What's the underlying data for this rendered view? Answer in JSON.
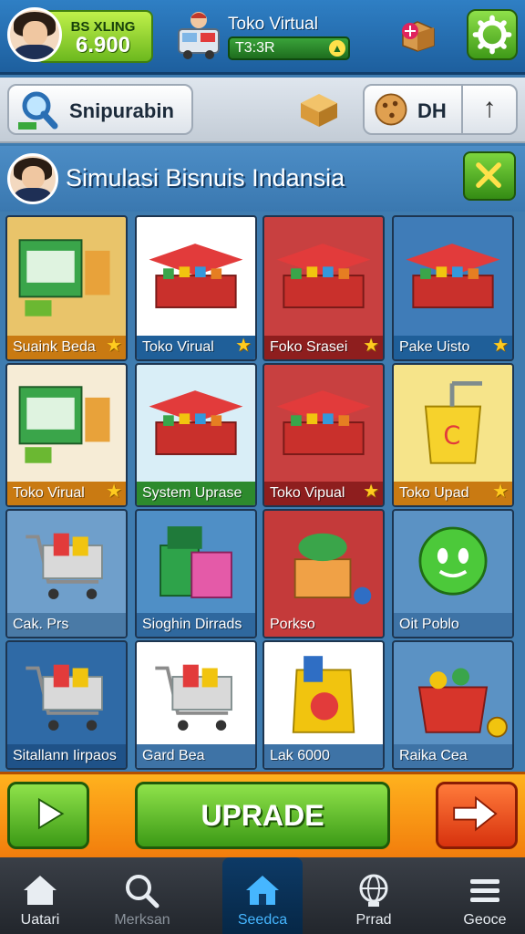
{
  "hud": {
    "balance_label": "BS XLING",
    "balance_value": "6.900",
    "store_name": "Toko Virtual",
    "timer": "T3:3R"
  },
  "toolbar": {
    "search_label": "Snipurabin",
    "dh_label": "DH"
  },
  "title": "Simulasi Bisnuis Indansia",
  "tiles": [
    {
      "label": "Suaink Beda",
      "star": true,
      "bg": "#e9c46a",
      "labelbg": "#c97a12"
    },
    {
      "label": "Toko Virual",
      "star": true,
      "bg": "#ffffff",
      "labelbg": "#1f5f99"
    },
    {
      "label": "Foko Srasei",
      "star": true,
      "bg": "#c84040",
      "labelbg": "#8e1e1e"
    },
    {
      "label": "Pake Uisto",
      "star": true,
      "bg": "#3f7cb8",
      "labelbg": "#1f5f99"
    },
    {
      "label": "Toko Virual",
      "star": true,
      "bg": "#f6ecd6",
      "labelbg": "#c97a12"
    },
    {
      "label": "System Uprase",
      "star": false,
      "bg": "#d9eef7",
      "labelbg": "#2d8a2d"
    },
    {
      "label": "Toko Vipual",
      "star": true,
      "bg": "#c84040",
      "labelbg": "#8e1e1e"
    },
    {
      "label": "Toko Upad",
      "star": true,
      "bg": "#f6e48a",
      "labelbg": "#c97a12"
    },
    {
      "label": "Cak. Prs",
      "star": false,
      "bg": "#6f9fcb",
      "labelbg": "#4a7aa6"
    },
    {
      "label": "Sioghin Dirrads",
      "star": false,
      "bg": "#4f8fc6",
      "labelbg": "#2f689e"
    },
    {
      "label": "Porkso",
      "star": false,
      "bg": "#c43a3a",
      "labelbg": "#c43a3a"
    },
    {
      "label": "Oit Poblo",
      "star": false,
      "bg": "#5b92c4",
      "labelbg": "#3e73a6"
    },
    {
      "label": "Sitallann Iirpaos",
      "star": false,
      "bg": "#2f6aa6",
      "labelbg": "#1f5288"
    },
    {
      "label": "Gard Bea",
      "star": false,
      "bg": "#ffffff",
      "labelbg": "#3e73a6"
    },
    {
      "label": "Lak 6000",
      "star": false,
      "bg": "#ffffff",
      "labelbg": "#3e73a6"
    },
    {
      "label": "Raika Cea",
      "star": false,
      "bg": "#5b92c4",
      "labelbg": "#3e73a6"
    }
  ],
  "actions": {
    "upgrade_label": "UPRADE"
  },
  "nav": [
    {
      "label": "Uatari",
      "icon": "home-icon"
    },
    {
      "label": "Merksan",
      "icon": "search-icon"
    },
    {
      "label": "Seedca",
      "icon": "home-icon"
    },
    {
      "label": "Prrad",
      "icon": "globe-icon"
    },
    {
      "label": "Geoce",
      "icon": "menu-icon"
    }
  ],
  "colors": {
    "hud": "#2f7fc4",
    "accent_green": "#5fb82a",
    "accent_orange": "#f5900f",
    "nav_active": "#46b6ff"
  }
}
